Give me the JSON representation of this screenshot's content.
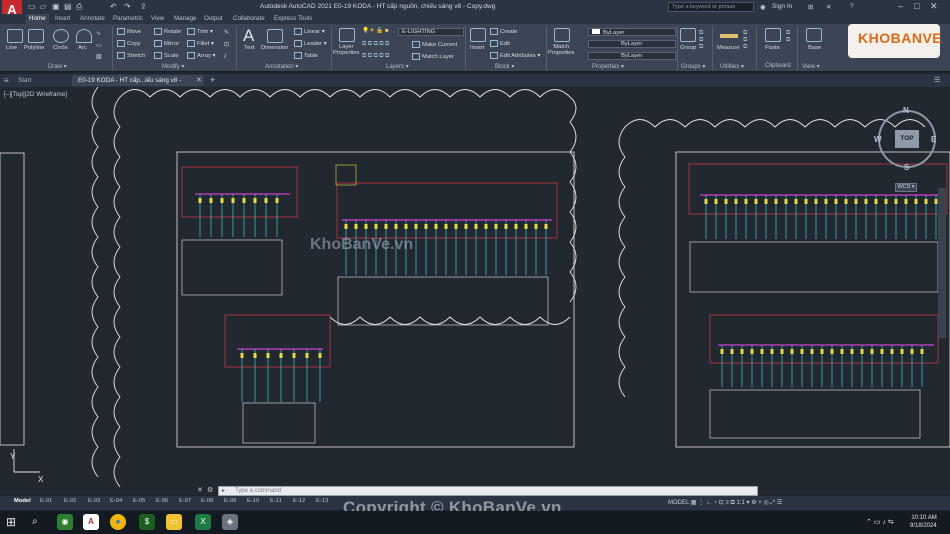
{
  "app": {
    "logo_letter": "A",
    "title": "Autodesk AutoCAD 2021    E0-19 KODA - HT cấp nguồn, chiếu sáng v8 - Copy.dwg"
  },
  "search": {
    "placeholder": "Type a keyword or phrase"
  },
  "account": {
    "sign_in": "Sign In"
  },
  "ribbon_tabs": [
    "Home",
    "Insert",
    "Annotate",
    "Parametric",
    "View",
    "Manage",
    "Output",
    "Collaborate",
    "Express Tools"
  ],
  "draw": {
    "line": "Line",
    "polyline": "Polyline",
    "circle": "Circle",
    "arc": "Arc",
    "panel": "Draw ▾"
  },
  "modify": {
    "move": "Move",
    "rotate": "Rotate",
    "trim": "Trim ▾",
    "copy": "Copy",
    "mirror": "Mirror",
    "fillet": "Fillet ▾",
    "stretch": "Stretch",
    "scale": "Scale",
    "array": "Array ▾",
    "panel": "Modify ▾"
  },
  "annotation": {
    "text": "Text",
    "dimension": "Dimension",
    "linear": "Linear ▾",
    "leader": "Leader ▾",
    "table": "Table",
    "panel": "Annotation ▾"
  },
  "layers": {
    "properties": "Layer\nProperties",
    "current_layer": "E-LIGHTING",
    "make_current": "Make Current",
    "match_layer": "Match Layer",
    "panel": "Layers ▾"
  },
  "block": {
    "insert": "Insert",
    "create": "Create",
    "edit": "Edit",
    "edit_attributes": "Edit Attributes ▾",
    "panel": "Block ▾"
  },
  "properties": {
    "match": "Match\nProperties",
    "color": "ByLayer",
    "linetype": "ByLayer",
    "lineweight": "ByLayer",
    "panel": "Properties ▾"
  },
  "groups": {
    "group": "Group",
    "panel": "Groups ▾"
  },
  "utilities": {
    "measure": "Measure",
    "panel": "Utilities ▾"
  },
  "clipboard": {
    "paste": "Paste",
    "panel": "Clipboard"
  },
  "view_panel": {
    "base": "Base",
    "panel": "View ▾"
  },
  "brand": {
    "logo_text": "KHOBANVE"
  },
  "doc_tabs": {
    "start": "Start",
    "active": "E0-19 KODA - HT cấp...iếu sáng v8 - Copy*"
  },
  "viewport": {
    "label": "[–][Top][2D Wireframe]"
  },
  "viewcube": {
    "top": "TOP",
    "n": "N",
    "s": "S",
    "e": "E",
    "w": "W",
    "wcs": "WCS ▾"
  },
  "command": {
    "placeholder": "Type a command"
  },
  "layout_tabs": [
    "Model",
    "E-01",
    "E-02",
    "E-03",
    "E-04",
    "E-05",
    "E-06",
    "E-07",
    "E-08",
    "E-09",
    "E-10",
    "E-11",
    "E-12",
    "E-13"
  ],
  "status": {
    "model": "MODEL",
    "scale": "1:1 ▾"
  },
  "watermark": "KhoBanVe.vn",
  "copyright": "Copyright © KhoBanVe.vn",
  "ucs": {
    "x": "X",
    "y": "Y"
  },
  "clock": {
    "time": "10:10 AM",
    "date": "9/18/2024"
  },
  "colors": {
    "accent_red": "#c8282e",
    "drawing_red": "#c8343c",
    "drawing_cyan": "#3cc8d2",
    "drawing_magenta": "#d23cd2",
    "drawing_yellow": "#e6dc3c",
    "drawing_white": "#e8e8e8"
  }
}
